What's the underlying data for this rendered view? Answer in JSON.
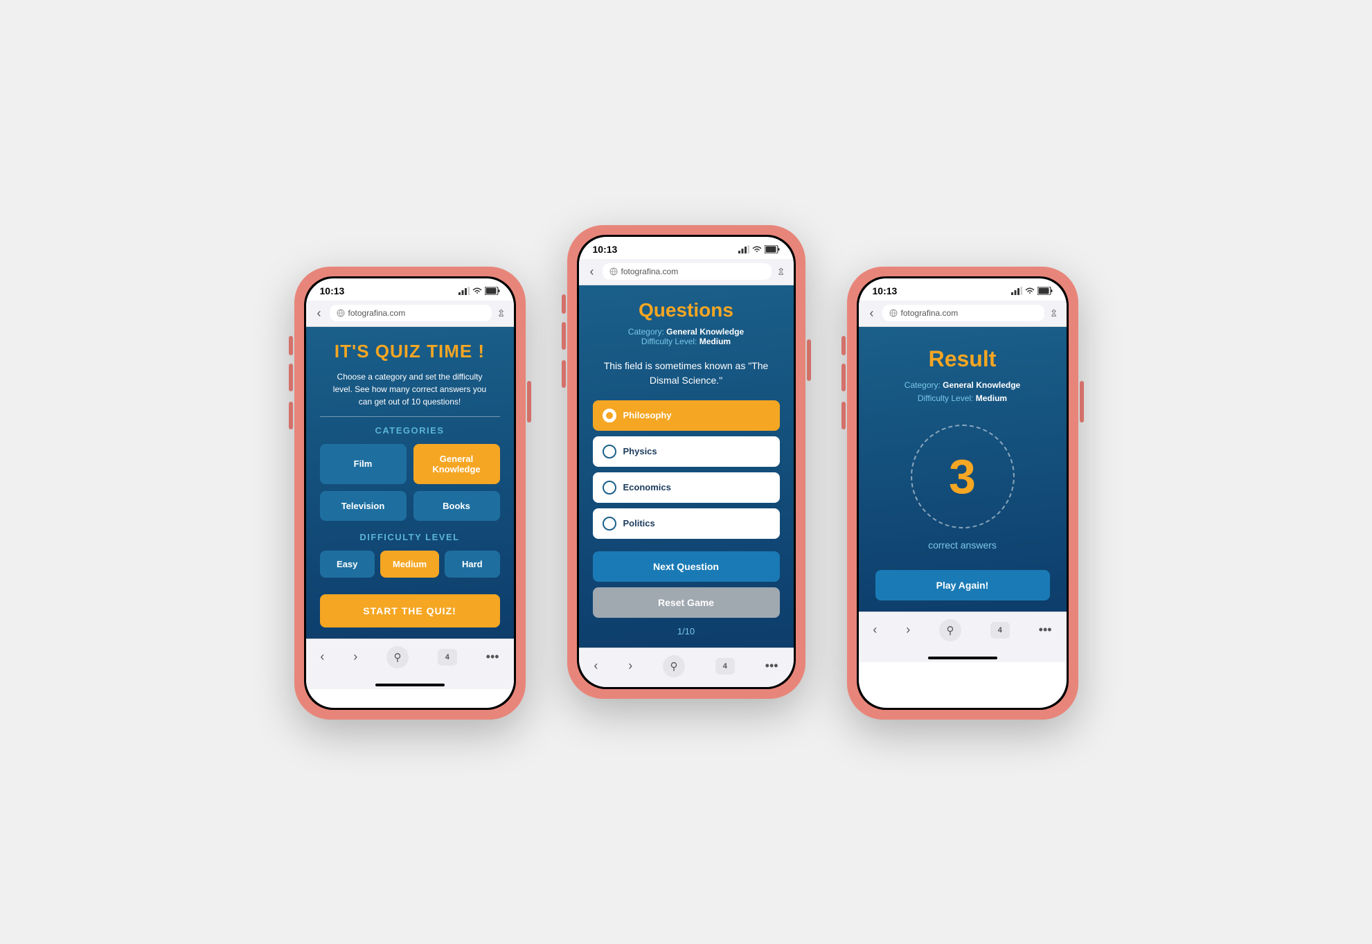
{
  "phones": [
    {
      "id": "phone1",
      "statusBar": {
        "time": "10:13",
        "signal": "●●●",
        "wifi": "wifi",
        "battery": "battery"
      },
      "browserBar": {
        "url": "fotografina.com"
      },
      "screen": {
        "title": "IT'S QUIZ TIME !",
        "subtitle": "Choose a category and set the difficulty level. See how many correct answers you can get out of 10 questions!",
        "categoriesLabel": "CATEGORIES",
        "categories": [
          {
            "label": "Film",
            "active": false
          },
          {
            "label": "General Knowledge",
            "active": true
          },
          {
            "label": "Television",
            "active": false
          },
          {
            "label": "Books",
            "active": false
          }
        ],
        "difficultyLabel": "DIFFICULTY LEVEL",
        "difficulties": [
          {
            "label": "Easy",
            "active": false
          },
          {
            "label": "Medium",
            "active": true
          },
          {
            "label": "Hard",
            "active": false
          }
        ],
        "startButton": "START THE QUIZ!"
      },
      "bottomNav": {
        "items": [
          "‹",
          "›",
          "⌕",
          "⊞",
          "···"
        ]
      }
    },
    {
      "id": "phone2",
      "statusBar": {
        "time": "10:13",
        "signal": "●●●",
        "wifi": "wifi",
        "battery": "battery"
      },
      "browserBar": {
        "url": "fotografina.com"
      },
      "screen": {
        "title": "Questions",
        "categoryLabel": "Category:",
        "categoryValue": "General Knowledge",
        "difficultyLabel": "Difficulty Level:",
        "difficultyValue": "Medium",
        "question": "This field is sometimes known as \"The Dismal Science.\"",
        "answers": [
          {
            "label": "Philosophy",
            "selected": true
          },
          {
            "label": "Physics",
            "selected": false
          },
          {
            "label": "Economics",
            "selected": false
          },
          {
            "label": "Politics",
            "selected": false
          }
        ],
        "nextButton": "Next Question",
        "resetButton": "Reset Game",
        "progress": "1/10"
      },
      "bottomNav": {
        "items": [
          "‹",
          "›",
          "⌕",
          "⊞",
          "···"
        ]
      }
    },
    {
      "id": "phone3",
      "statusBar": {
        "time": "10:13",
        "signal": "●●●",
        "wifi": "wifi",
        "battery": "battery"
      },
      "browserBar": {
        "url": "fotografina.com"
      },
      "screen": {
        "title": "Result",
        "categoryLabel": "Category:",
        "categoryValue": "General Knowledge",
        "difficultyLabel": "Difficulty Level:",
        "difficultyValue": "Medium",
        "score": "3",
        "correctLabel": "correct answers",
        "playAgainButton": "Play Again!"
      },
      "bottomNav": {
        "items": [
          "‹",
          "›",
          "⌕",
          "⊞",
          "···"
        ]
      }
    }
  ]
}
